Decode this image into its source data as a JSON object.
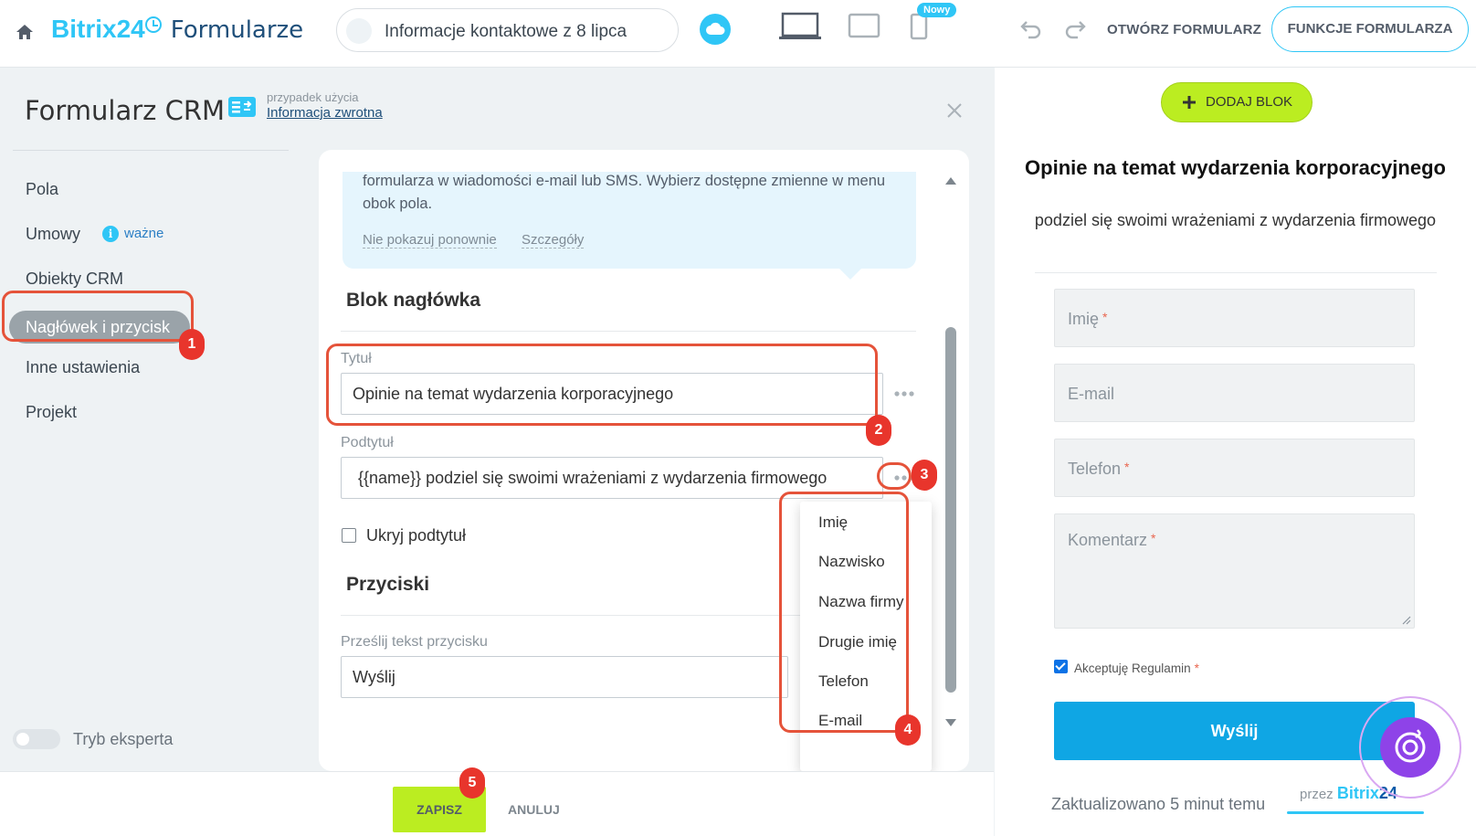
{
  "header": {
    "brand_b24": "Bitrix24",
    "brand_product": "Formularze",
    "form_name": "Informacje kontaktowe z 8 lipca",
    "new_badge": "Nowy",
    "open_form_label": "OTWÓRZ FORMULARZ",
    "features_label": "FUNKCJE FORMULARZA",
    "accent_color": "#2fc6f6"
  },
  "panel": {
    "title": "Formularz CRM",
    "usecase_label": "przypadek użycia",
    "usecase_link": "Informacja zwrotna"
  },
  "sidebar": {
    "items": [
      {
        "label": "Pola"
      },
      {
        "label": "Umowy"
      },
      {
        "label": "Obiekty CRM"
      },
      {
        "label": "Nagłówek i przycisk"
      },
      {
        "label": "Inne ustawienia"
      },
      {
        "label": "Projekt"
      }
    ],
    "important_label": "ważne",
    "expert_mode_label": "Tryb eksperta"
  },
  "hint": {
    "text": "formularza w wiadomości e-mail lub SMS. Wybierz dostępne zmienne w menu obok pola.",
    "dont_show_label": "Nie pokazuj ponownie",
    "details_label": "Szczegóły"
  },
  "header_block": {
    "section_title": "Blok nagłówka",
    "title_label": "Tytuł",
    "title_value": "Opinie na temat wydarzenia korporacyjnego",
    "subtitle_label": "Podtytuł",
    "subtitle_value": "{{name}} podziel się swoimi wrażeniami z wydarzenia firmowego",
    "hide_subtitle_label": "Ukryj podtytuł"
  },
  "buttons_block": {
    "section_title": "Przyciski",
    "submit_label": "Prześlij tekst przycisku",
    "submit_value": "Wyślij"
  },
  "variables_menu": {
    "items": [
      "Imię",
      "Nazwisko",
      "Nazwa firmy",
      "Drugie imię",
      "Telefon",
      "E-mail"
    ]
  },
  "footer": {
    "save_label": "ZAPISZ",
    "cancel_label": "ANULUJ"
  },
  "preview": {
    "add_block_label": "DODAJ BLOK",
    "title": "Opinie na temat wydarzenia korporacyjnego",
    "subtitle": "podziel się swoimi wrażeniami z wydarzenia firmowego",
    "fields": [
      {
        "label": "Imię",
        "required": "*"
      },
      {
        "label": "E-mail",
        "required": ""
      },
      {
        "label": "Telefon",
        "required": "*"
      },
      {
        "label": "Komentarz",
        "required": "*"
      }
    ],
    "accept_label": "Akceptuję Regulamin",
    "accept_required": "*",
    "send_label": "Wyślij",
    "updated_label": "Zaktualizowano 5 minut temu",
    "by_label": "przez",
    "by_brand_a": "Bitrix",
    "by_brand_b": "24"
  },
  "annotations": [
    "1",
    "2",
    "3",
    "4",
    "5"
  ]
}
